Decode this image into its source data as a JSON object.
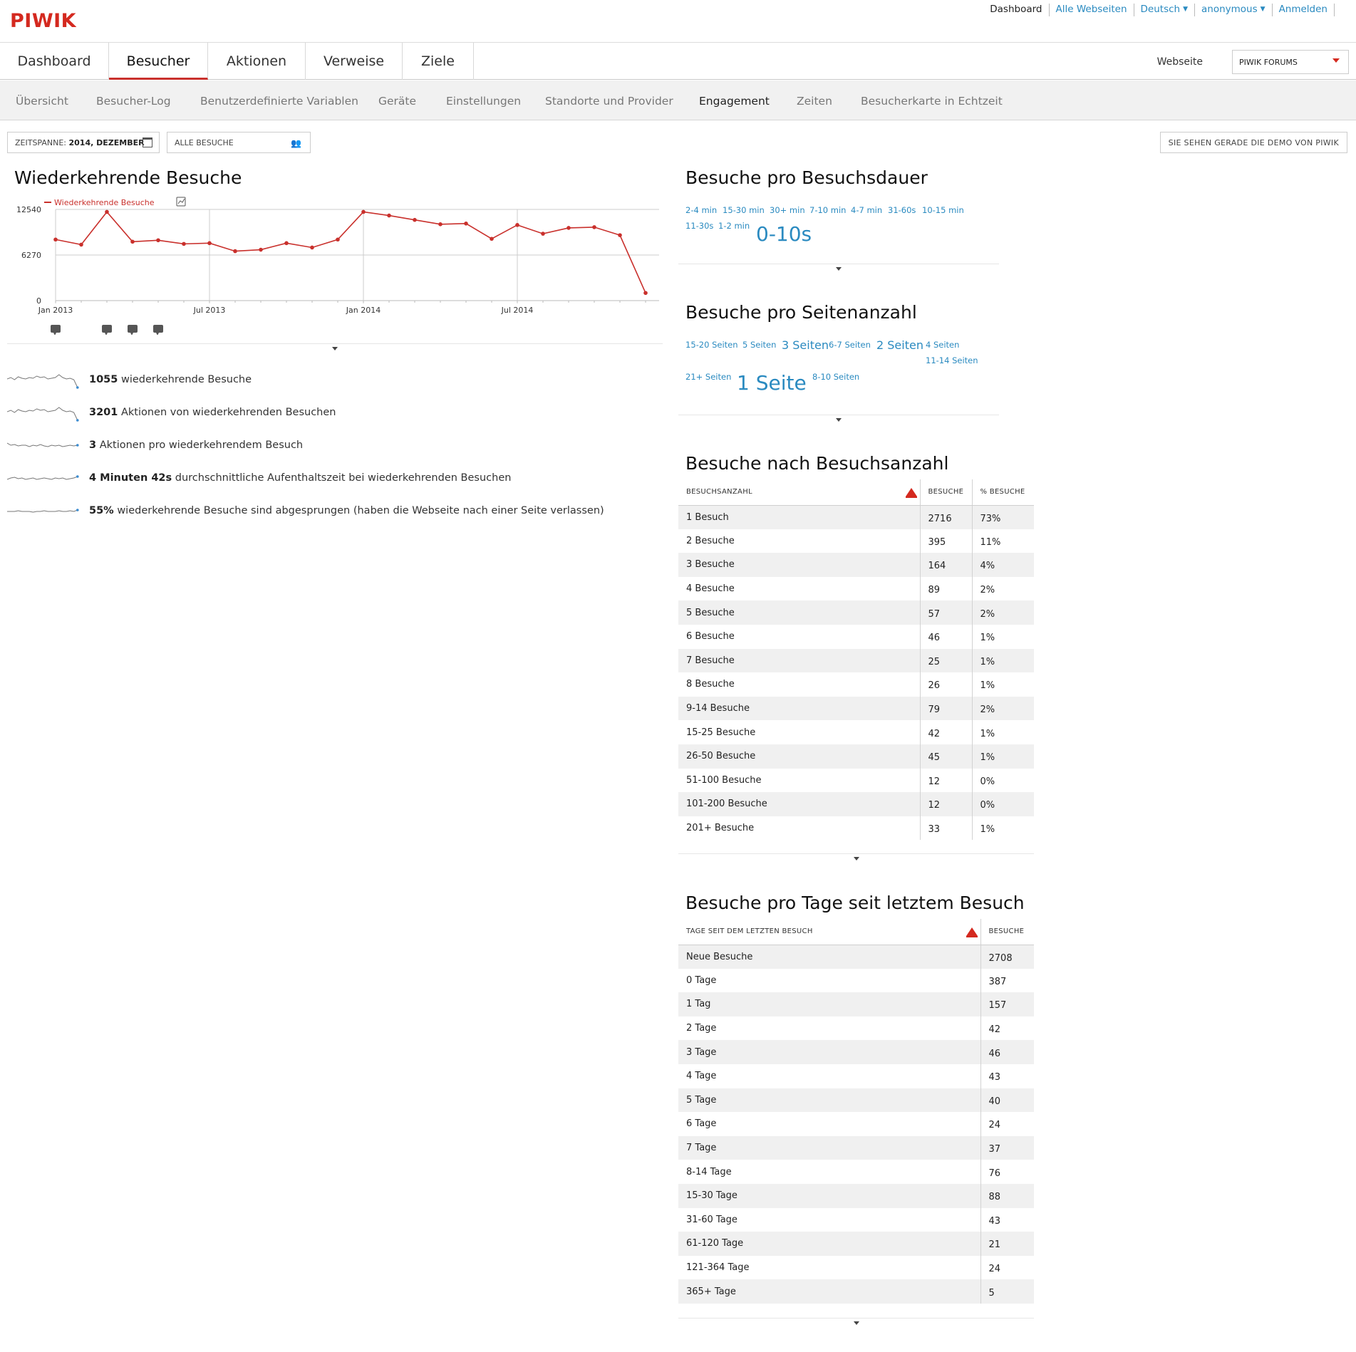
{
  "brand": {
    "logo": "PIWIK",
    "color": "#d4291f",
    "link_color": "#2a8ac0"
  },
  "top_links": {
    "dashboard": "Dashboard",
    "all_websites": "Alle Webseiten",
    "language": "Deutsch",
    "user": "anonymous",
    "login": "Anmelden"
  },
  "main_menu": {
    "tabs": [
      "Dashboard",
      "Besucher",
      "Aktionen",
      "Verweise",
      "Ziele"
    ],
    "active": "Besucher"
  },
  "site_selector": {
    "label": "Webseite",
    "value": "PIWIK FORUMS"
  },
  "sub_menu": {
    "tabs": [
      "Übersicht",
      "Besucher-Log",
      "Benutzerdefinierte Variablen",
      "Geräte",
      "Einstellungen",
      "Standorte und Provider",
      "Engagement",
      "Zeiten",
      "Besucherkarte in Echtzeit"
    ],
    "active": "Engagement"
  },
  "controls": {
    "period_label": "ZEITSPANNE:",
    "period_value": "2014, DEZEMBER",
    "segment": "ALLE BESUCHE",
    "demo_notice": "SIE SEHEN GERADE DIE DEMO VON PIWIK"
  },
  "returning": {
    "title": "Wiederkehrende Besuche",
    "chart_data": {
      "type": "line",
      "title": "Wiederkehrende Besuche",
      "series": [
        {
          "name": "Wiederkehrende Besuche",
          "color": "#c9302c",
          "values": [
            8400,
            7700,
            12200,
            8100,
            8300,
            7800,
            7900,
            6800,
            7000,
            7900,
            7300,
            8400,
            12200,
            11700,
            11100,
            10500,
            10600,
            8500,
            10400,
            9200,
            10000,
            10100,
            9000,
            1050
          ]
        }
      ],
      "x": [
        "2013-01",
        "2013-02",
        "2013-03",
        "2013-04",
        "2013-05",
        "2013-06",
        "2013-07",
        "2013-08",
        "2013-09",
        "2013-10",
        "2013-11",
        "2013-12",
        "2014-01",
        "2014-02",
        "2014-03",
        "2014-04",
        "2014-05",
        "2014-06",
        "2014-07",
        "2014-08",
        "2014-09",
        "2014-10",
        "2014-11",
        "2014-12"
      ],
      "x_tick_labels": [
        "Jan 2013",
        "Jul 2013",
        "Jan 2014",
        "Jul 2014"
      ],
      "y_tick_labels": [
        "12540",
        "6270",
        "0"
      ],
      "ylim": [
        0,
        12540
      ],
      "grid": true,
      "legend": "top-left",
      "annotation_months": [
        "2013-01",
        "2013-03",
        "2013-04",
        "2013-05"
      ]
    },
    "sparklines": [
      {
        "value": "1055",
        "text": "wiederkehrende Besuche"
      },
      {
        "value": "3201",
        "text": "Aktionen von wiederkehrenden Besuchen"
      },
      {
        "value": "3",
        "text": "Aktionen pro wiederkehrendem Besuch"
      },
      {
        "value": "4 Minuten 42s",
        "text": "durchschnittliche Aufenthaltszeit bei wiederkehrenden Besuchen"
      },
      {
        "value": "55%",
        "text": "wiederkehrende Besuche sind abgesprungen (haben die Webseite nach einer Seite verlassen)"
      }
    ]
  },
  "duration": {
    "title": "Besuche pro Besuchsdauer",
    "tags": [
      "2-4 min",
      "15-30 min",
      "30+ min",
      "7-10 min",
      "4-7 min",
      "31-60s",
      "10-15 min",
      "11-30s",
      "1-2 min",
      "0-10s"
    ]
  },
  "pages": {
    "title": "Besuche pro Seitenanzahl",
    "tags": [
      "15-20 Seiten",
      "5 Seiten",
      "3 Seiten",
      "6-7 Seiten",
      "2 Seiten",
      "4 Seiten",
      "11-14 Seiten",
      "21+ Seiten",
      "1 Seite",
      "8-10 Seiten"
    ]
  },
  "visit_count": {
    "title": "Besuche nach Besuchsanzahl",
    "headers": [
      "BESUCHSANZAHL",
      "BESUCHE",
      "% BESUCHE"
    ],
    "rows": [
      [
        "1 Besuch",
        "2716",
        "73%"
      ],
      [
        "2 Besuche",
        "395",
        "11%"
      ],
      [
        "3 Besuche",
        "164",
        "4%"
      ],
      [
        "4 Besuche",
        "89",
        "2%"
      ],
      [
        "5 Besuche",
        "57",
        "2%"
      ],
      [
        "6 Besuche",
        "46",
        "1%"
      ],
      [
        "7 Besuche",
        "25",
        "1%"
      ],
      [
        "8 Besuche",
        "26",
        "1%"
      ],
      [
        "9-14 Besuche",
        "79",
        "2%"
      ],
      [
        "15-25 Besuche",
        "42",
        "1%"
      ],
      [
        "26-50 Besuche",
        "45",
        "1%"
      ],
      [
        "51-100 Besuche",
        "12",
        "0%"
      ],
      [
        "101-200 Besuche",
        "12",
        "0%"
      ],
      [
        "201+ Besuche",
        "33",
        "1%"
      ]
    ]
  },
  "days_since": {
    "title": "Besuche pro Tage seit letztem Besuch",
    "headers": [
      "TAGE SEIT DEM LETZTEN BESUCH",
      "BESUCHE"
    ],
    "rows": [
      [
        "Neue Besuche",
        "2708"
      ],
      [
        "0 Tage",
        "387"
      ],
      [
        "1 Tag",
        "157"
      ],
      [
        "2 Tage",
        "42"
      ],
      [
        "3 Tage",
        "46"
      ],
      [
        "4 Tage",
        "43"
      ],
      [
        "5 Tage",
        "40"
      ],
      [
        "6 Tage",
        "24"
      ],
      [
        "7 Tage",
        "37"
      ],
      [
        "8-14 Tage",
        "76"
      ],
      [
        "15-30 Tage",
        "88"
      ],
      [
        "31-60 Tage",
        "43"
      ],
      [
        "61-120 Tage",
        "21"
      ],
      [
        "121-364 Tage",
        "24"
      ],
      [
        "365+ Tage",
        "5"
      ]
    ]
  }
}
